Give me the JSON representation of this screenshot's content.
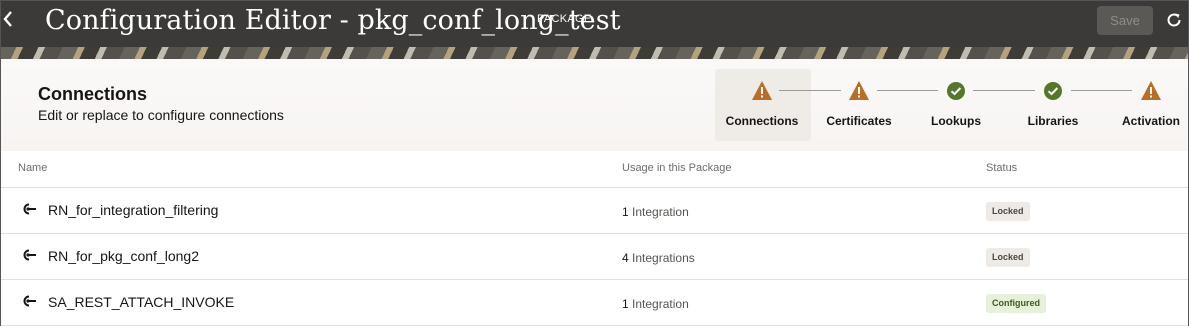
{
  "header": {
    "title": "Configuration Editor - pkg_conf_long_test",
    "badge": "PACKAGE",
    "save_label": "Save"
  },
  "section": {
    "title": "Connections",
    "subtitle": "Edit or replace to configure connections"
  },
  "train": [
    {
      "label": "Connections",
      "status": "warning"
    },
    {
      "label": "Certificates",
      "status": "warning"
    },
    {
      "label": "Lookups",
      "status": "success"
    },
    {
      "label": "Libraries",
      "status": "success"
    },
    {
      "label": "Activation",
      "status": "warning"
    }
  ],
  "table": {
    "columns": [
      "Name",
      "Usage in this Package",
      "Status"
    ],
    "rows": [
      {
        "name": "RN_for_integration_filtering",
        "usage_count": "1",
        "usage_unit": "Integration",
        "status": "Locked"
      },
      {
        "name": "RN_for_pkg_conf_long2",
        "usage_count": "4",
        "usage_unit": "Integrations",
        "status": "Locked"
      },
      {
        "name": "SA_REST_ATTACH_INVOKE",
        "usage_count": "1",
        "usage_unit": "Integration",
        "status": "Configured"
      }
    ]
  },
  "colors": {
    "header_bg": "#3b3a38",
    "warning": "#b86e26",
    "success": "#53782c",
    "locked_bg": "#eeeae6",
    "configured_bg": "#e7f0d9"
  }
}
